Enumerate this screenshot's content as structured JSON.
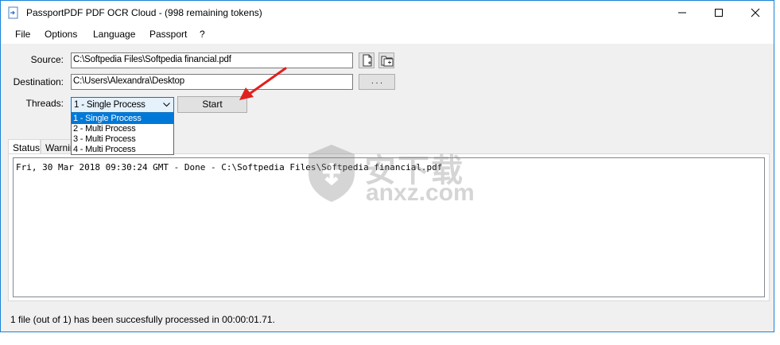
{
  "window": {
    "title": "PassportPDF PDF OCR Cloud - (998 remaining tokens)",
    "accent_color": "#1883d7"
  },
  "menu": {
    "items": [
      "File",
      "Options",
      "Language",
      "Passport",
      "?"
    ]
  },
  "form": {
    "source_label": "Source:",
    "source_value": "C:\\Softpedia Files\\Softpedia financial.pdf",
    "destination_label": "Destination:",
    "destination_value": "C:\\Users\\Alexandra\\Desktop",
    "browse_label": ". . .",
    "threads_label": "Threads:",
    "threads_selected": "1 - Single Process",
    "threads_options": [
      "1 - Single Process",
      "2 - Multi Process",
      "3 - Multi Process",
      "4 - Multi Process"
    ],
    "start_label": "Start",
    "icons": [
      "add-file-icon",
      "add-folder-icon"
    ]
  },
  "tabs": {
    "status": "Status",
    "warnings": "Warnin"
  },
  "log": {
    "line": "Fri, 30 Mar 2018 09:30:24 GMT - Done - C:\\Softpedia Files\\Softpedia financial.pdf"
  },
  "status_bar": {
    "text": "1 file (out of 1) has been succesfully processed in 00:00:01.71."
  },
  "watermark": {
    "chinese": "安下载",
    "domain": "anxz.com"
  },
  "annotation": {
    "arrow_color": "#e0201e"
  }
}
